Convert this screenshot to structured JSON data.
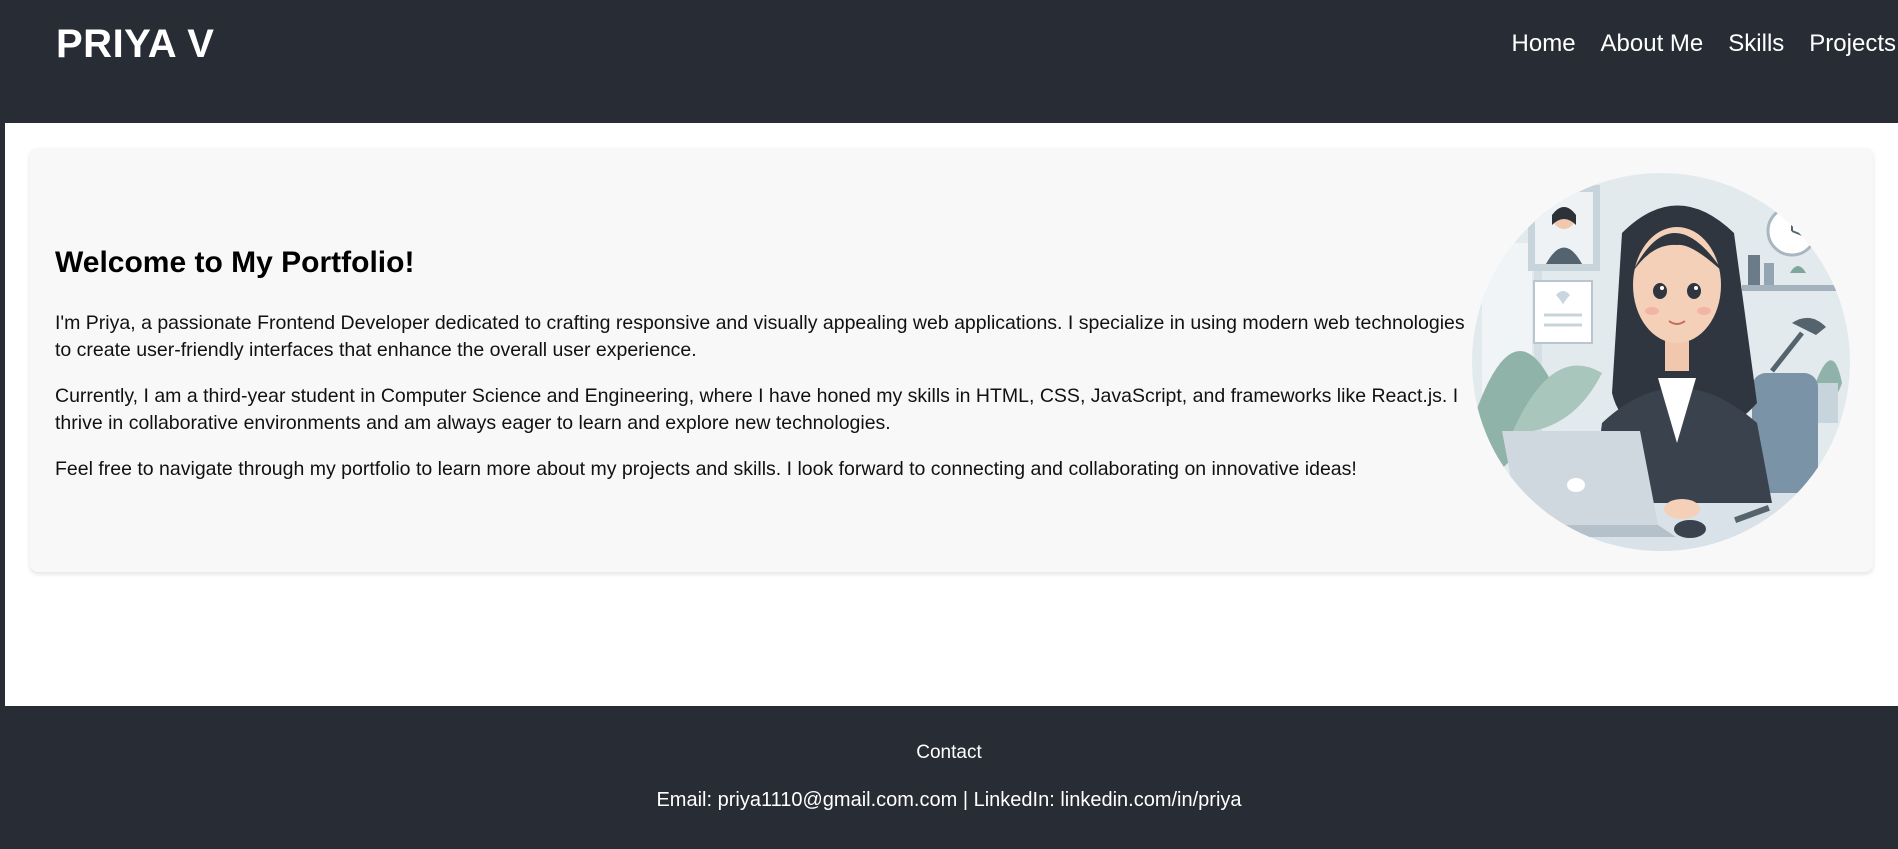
{
  "header": {
    "brand": "PRIYA V",
    "nav": [
      "Home",
      "About Me",
      "Skills",
      "Projects"
    ]
  },
  "welcome": {
    "title": "Welcome to My Portfolio!",
    "paragraphs": [
      "I'm Priya, a passionate Frontend Developer dedicated to crafting responsive and visually appealing web applications. I specialize in using modern web technologies to create user-friendly interfaces that enhance the overall user experience.",
      "Currently, I am a third-year student in Computer Science and Engineering, where I have honed my skills in HTML, CSS, JavaScript, and frameworks like React.js. I thrive in collaborative environments and am always eager to learn and explore new technologies.",
      "Feel free to navigate through my portfolio to learn more about my projects and skills. I look forward to connecting and collaborating on innovative ideas!"
    ]
  },
  "footer": {
    "title": "Contact",
    "email_label": "Email:",
    "email": "priya1110@gmail.com.com",
    "separator": "|",
    "linkedin_label": "LinkedIn:",
    "linkedin": "linkedin.com/in/priya"
  },
  "colors": {
    "dark": "#282c34",
    "card_bg": "#f8f8f8"
  },
  "illustration": "woman-developer-at-laptop-illustration"
}
